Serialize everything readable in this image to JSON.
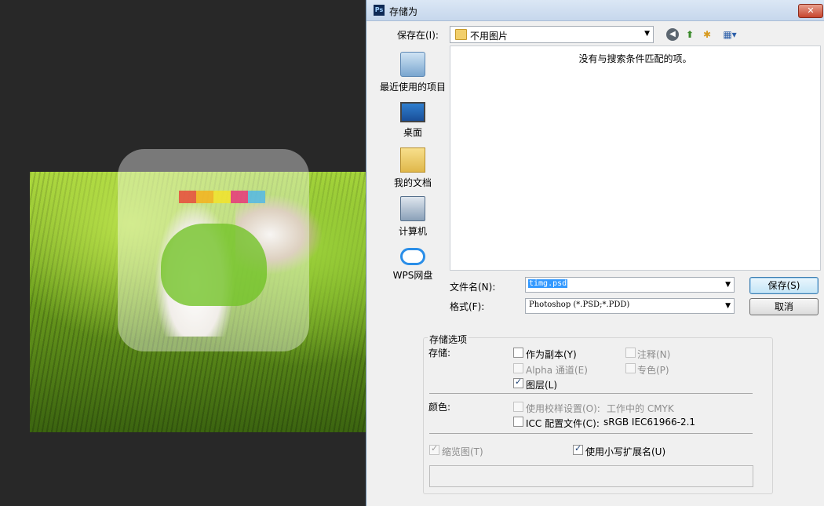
{
  "dialog": {
    "title": "存储为",
    "ps_icon_text": "Ps",
    "close_label": "✕",
    "save_in_label": "保存在(I):",
    "save_in_value": "不用图片",
    "empty_message": "没有与搜索条件匹配的项。",
    "places": [
      {
        "label": "最近使用的项目",
        "icon": "recent-items-icon"
      },
      {
        "label": "桌面",
        "icon": "desktop-icon"
      },
      {
        "label": "我的文档",
        "icon": "documents-icon"
      },
      {
        "label": "计算机",
        "icon": "computer-icon"
      },
      {
        "label": "WPS网盘",
        "icon": "cloud-icon"
      }
    ],
    "filename_label": "文件名(N):",
    "filename_value": "timg.psd",
    "format_label": "格式(F):",
    "format_value": "Photoshop (*.PSD;*.PDD)",
    "save_button": "保存(S)",
    "cancel_button": "取消"
  },
  "options": {
    "group_title": "存储选项",
    "storage_label": "存储:",
    "as_copy": {
      "label": "作为副本(Y)",
      "checked": false,
      "enabled": true
    },
    "notes": {
      "label": "注释(N)",
      "checked": false,
      "enabled": false
    },
    "alpha": {
      "label": "Alpha 通道(E)",
      "checked": false,
      "enabled": false
    },
    "spot": {
      "label": "专色(P)",
      "checked": false,
      "enabled": false
    },
    "layers": {
      "label": "图层(L)",
      "checked": true,
      "enabled": true
    },
    "color_label": "颜色:",
    "proof": {
      "label": "使用校样设置(O):",
      "value": "工作中的 CMYK",
      "checked": false,
      "enabled": false
    },
    "icc": {
      "label": "ICC 配置文件(C):",
      "value": "sRGB IEC61966-2.1",
      "checked": false,
      "enabled": true
    },
    "thumbnail": {
      "label": "缩览图(T)",
      "checked": true,
      "enabled": false
    },
    "lowercase_ext": {
      "label": "使用小写扩展名(U)",
      "checked": true,
      "enabled": true
    }
  },
  "colors": {
    "titlebar": "#c6d7ec",
    "selection": "#3399ff",
    "dialog_bg": "#f0f0f0",
    "app_bg": "#282828"
  }
}
